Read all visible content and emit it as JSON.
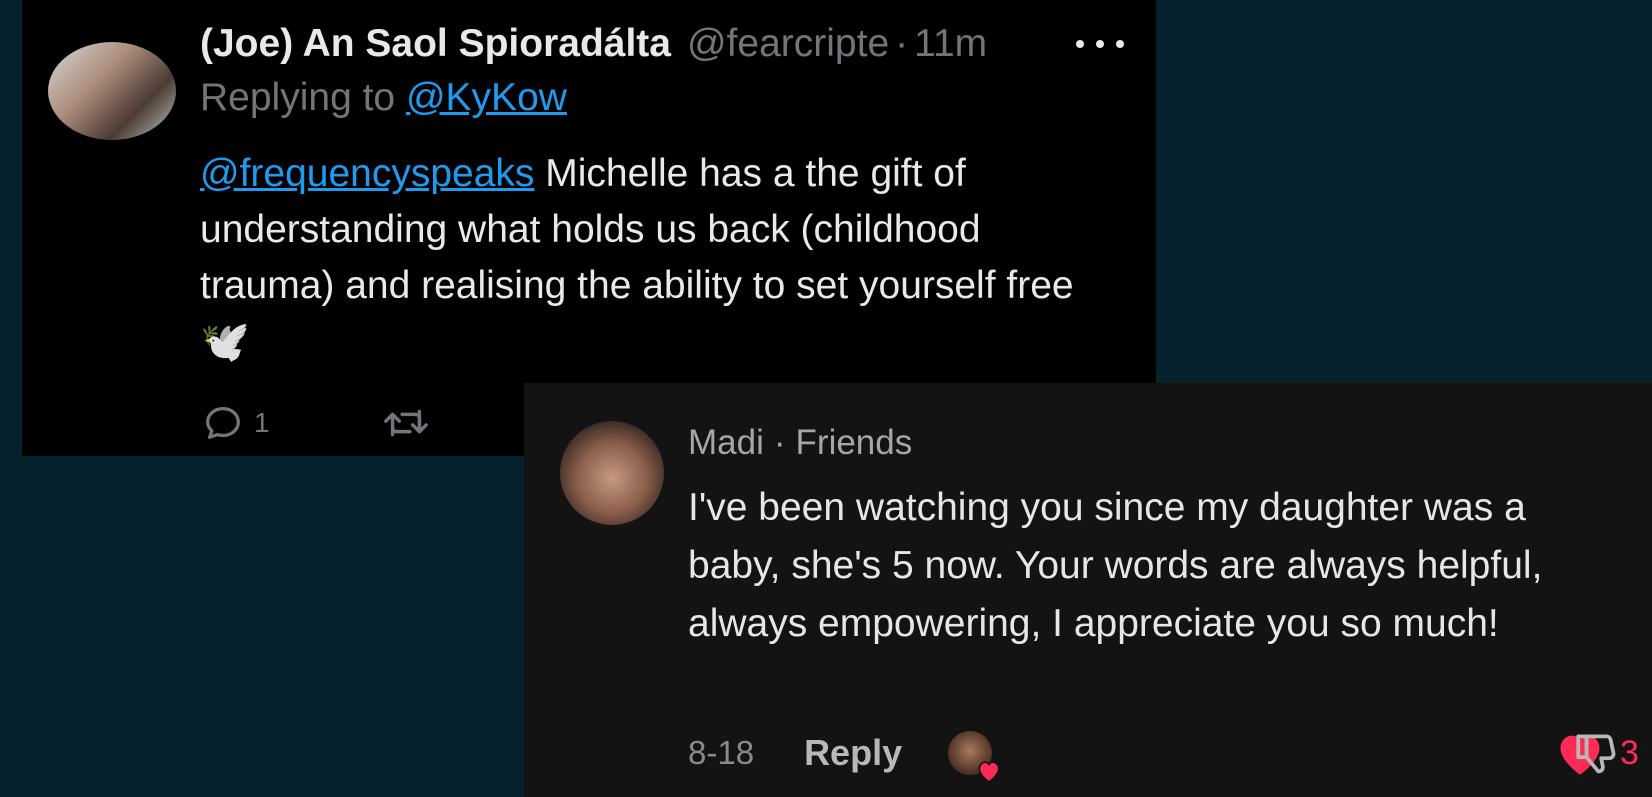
{
  "tweet": {
    "display_name": "(Joe) An Saol Spioradálta",
    "handle": "@fearcripte",
    "separator": "·",
    "time": "11m",
    "replying_prefix": "Replying to ",
    "replying_to": "@KyKow",
    "mention": "@frequencyspeaks",
    "body": " Michelle has a the gift of understanding what holds us back (childhood trauma) and realising the ability to set yourself free ",
    "emoji": "🕊️",
    "reply_count": "1"
  },
  "comment": {
    "author": "Madi",
    "separator": "·",
    "relation": "Friends",
    "text": "I've been watching you since my daughter was a baby, she's 5 now. Your words are always helpful, always empowering, I appreciate you so much!",
    "date": "8-18",
    "reply_label": "Reply",
    "like_count": "3"
  },
  "colors": {
    "background": "#05212b",
    "tweet_bg": "#000000",
    "comment_bg": "#131313",
    "link": "#1d9bf0",
    "like": "#fe2c55"
  }
}
